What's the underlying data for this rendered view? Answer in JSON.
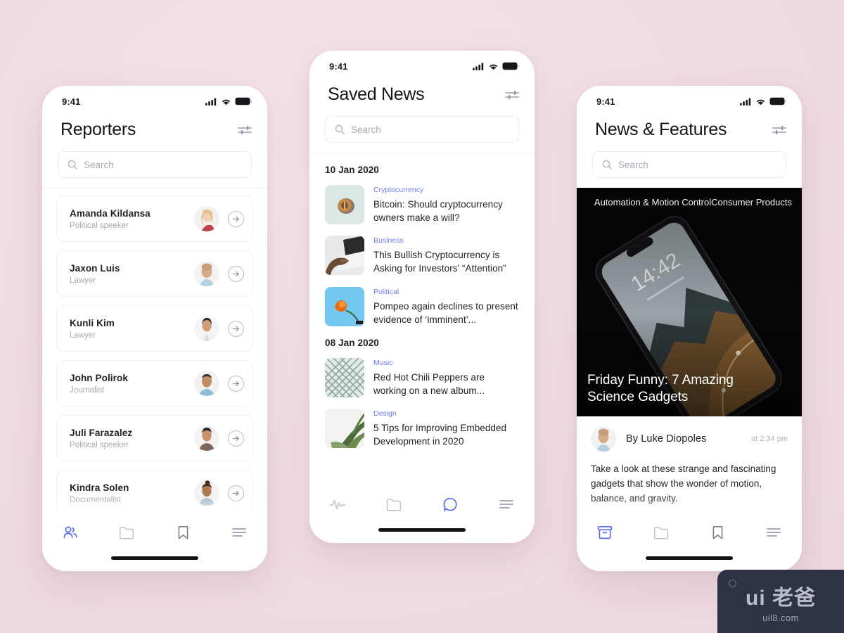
{
  "background_color": "#f1dce4",
  "accent_color": "#5b6ef0",
  "status_bar": {
    "time": "9:41",
    "icons": [
      "signal-icon",
      "wifi-icon",
      "battery-icon"
    ]
  },
  "phone_left": {
    "title": "Reporters",
    "filter_icon": "filter-sliders-icon",
    "search": {
      "placeholder": "Search",
      "value": "",
      "icon": "search-icon"
    },
    "reporters": [
      {
        "name": "Amanda Kildansa",
        "role": "Political speeker",
        "avatar": "avatar-blonde-woman"
      },
      {
        "name": "Jaxon Luis",
        "role": "Lawyer",
        "avatar": "avatar-bald-man"
      },
      {
        "name": "Kunli Kim",
        "role": "Lawyer",
        "avatar": "avatar-woman-white-jacket"
      },
      {
        "name": "John Polirok",
        "role": "Journalist",
        "avatar": "avatar-man-blue-shirt"
      },
      {
        "name": "Juli Farazalez",
        "role": "Political speeker",
        "avatar": "avatar-woman-brown-top"
      },
      {
        "name": "Kindra Solen",
        "role": "Documentalist",
        "avatar": "avatar-woman-bun"
      }
    ],
    "tabs": [
      {
        "icon": "people-icon",
        "active": true
      },
      {
        "icon": "folder-icon",
        "active": false
      },
      {
        "icon": "bookmark-icon",
        "active": false
      },
      {
        "icon": "menu-icon",
        "active": false
      }
    ]
  },
  "phone_center": {
    "title": "Saved News",
    "filter_icon": "filter-sliders-icon",
    "search": {
      "placeholder": "Search",
      "value": "",
      "icon": "search-icon"
    },
    "groups": [
      {
        "date": "10 Jan 2020",
        "articles": [
          {
            "category": "Cryptocurrency",
            "title": "Bitcoin: Should cryptocurrency owners make a will?",
            "thumb": "thumb-bitcoin-coin"
          },
          {
            "category": "Business",
            "title": "This Bullish Cryptocurrency is Asking for Investors’ “Attention”",
            "thumb": "thumb-hand-laptop"
          },
          {
            "category": "Political",
            "title": "Pompeo again declines to present evidence of ‘imminent’...",
            "thumb": "thumb-orange-poppy"
          }
        ]
      },
      {
        "date": "08 Jan 2020",
        "articles": [
          {
            "category": "Music",
            "title": "Red Hot Chili Peppers are working on a new album...",
            "thumb": "thumb-lattice-pattern"
          },
          {
            "category": "Design",
            "title": "5 Tips for Improving Embedded Development in 2020",
            "thumb": "thumb-green-grass"
          }
        ]
      }
    ],
    "tabs": [
      {
        "icon": "activity-pulse-icon",
        "active": false
      },
      {
        "icon": "folder-icon",
        "active": false
      },
      {
        "icon": "chat-bubble-icon",
        "active": true
      },
      {
        "icon": "menu-icon",
        "active": false
      }
    ]
  },
  "phone_right": {
    "title": "News & Features",
    "filter_icon": "filter-sliders-icon",
    "search": {
      "placeholder": "Search",
      "value": "",
      "icon": "search-icon"
    },
    "hero": {
      "kicker": "Automation & Motion ControlConsumer Products",
      "title": "Friday Funny: 7 Amazing Science Gadgets",
      "image": "dark-photo-tilted-phone-night-landscape",
      "phone_screen_time": "14:42"
    },
    "author": {
      "avatar": "avatar-bald-man",
      "name": "By Luke Diopoles",
      "time": "at 2:34 pm"
    },
    "excerpt": "Take a look at these strange and fascinating gadgets that show the wonder of motion, balance, and gravity.",
    "tabs": [
      {
        "icon": "archive-box-icon",
        "active": true
      },
      {
        "icon": "folder-icon",
        "active": false
      },
      {
        "icon": "bookmark-icon",
        "active": false
      },
      {
        "icon": "menu-icon",
        "active": false
      }
    ]
  },
  "watermark": {
    "main": "ui 老爸",
    "sub": "uil8.com"
  }
}
